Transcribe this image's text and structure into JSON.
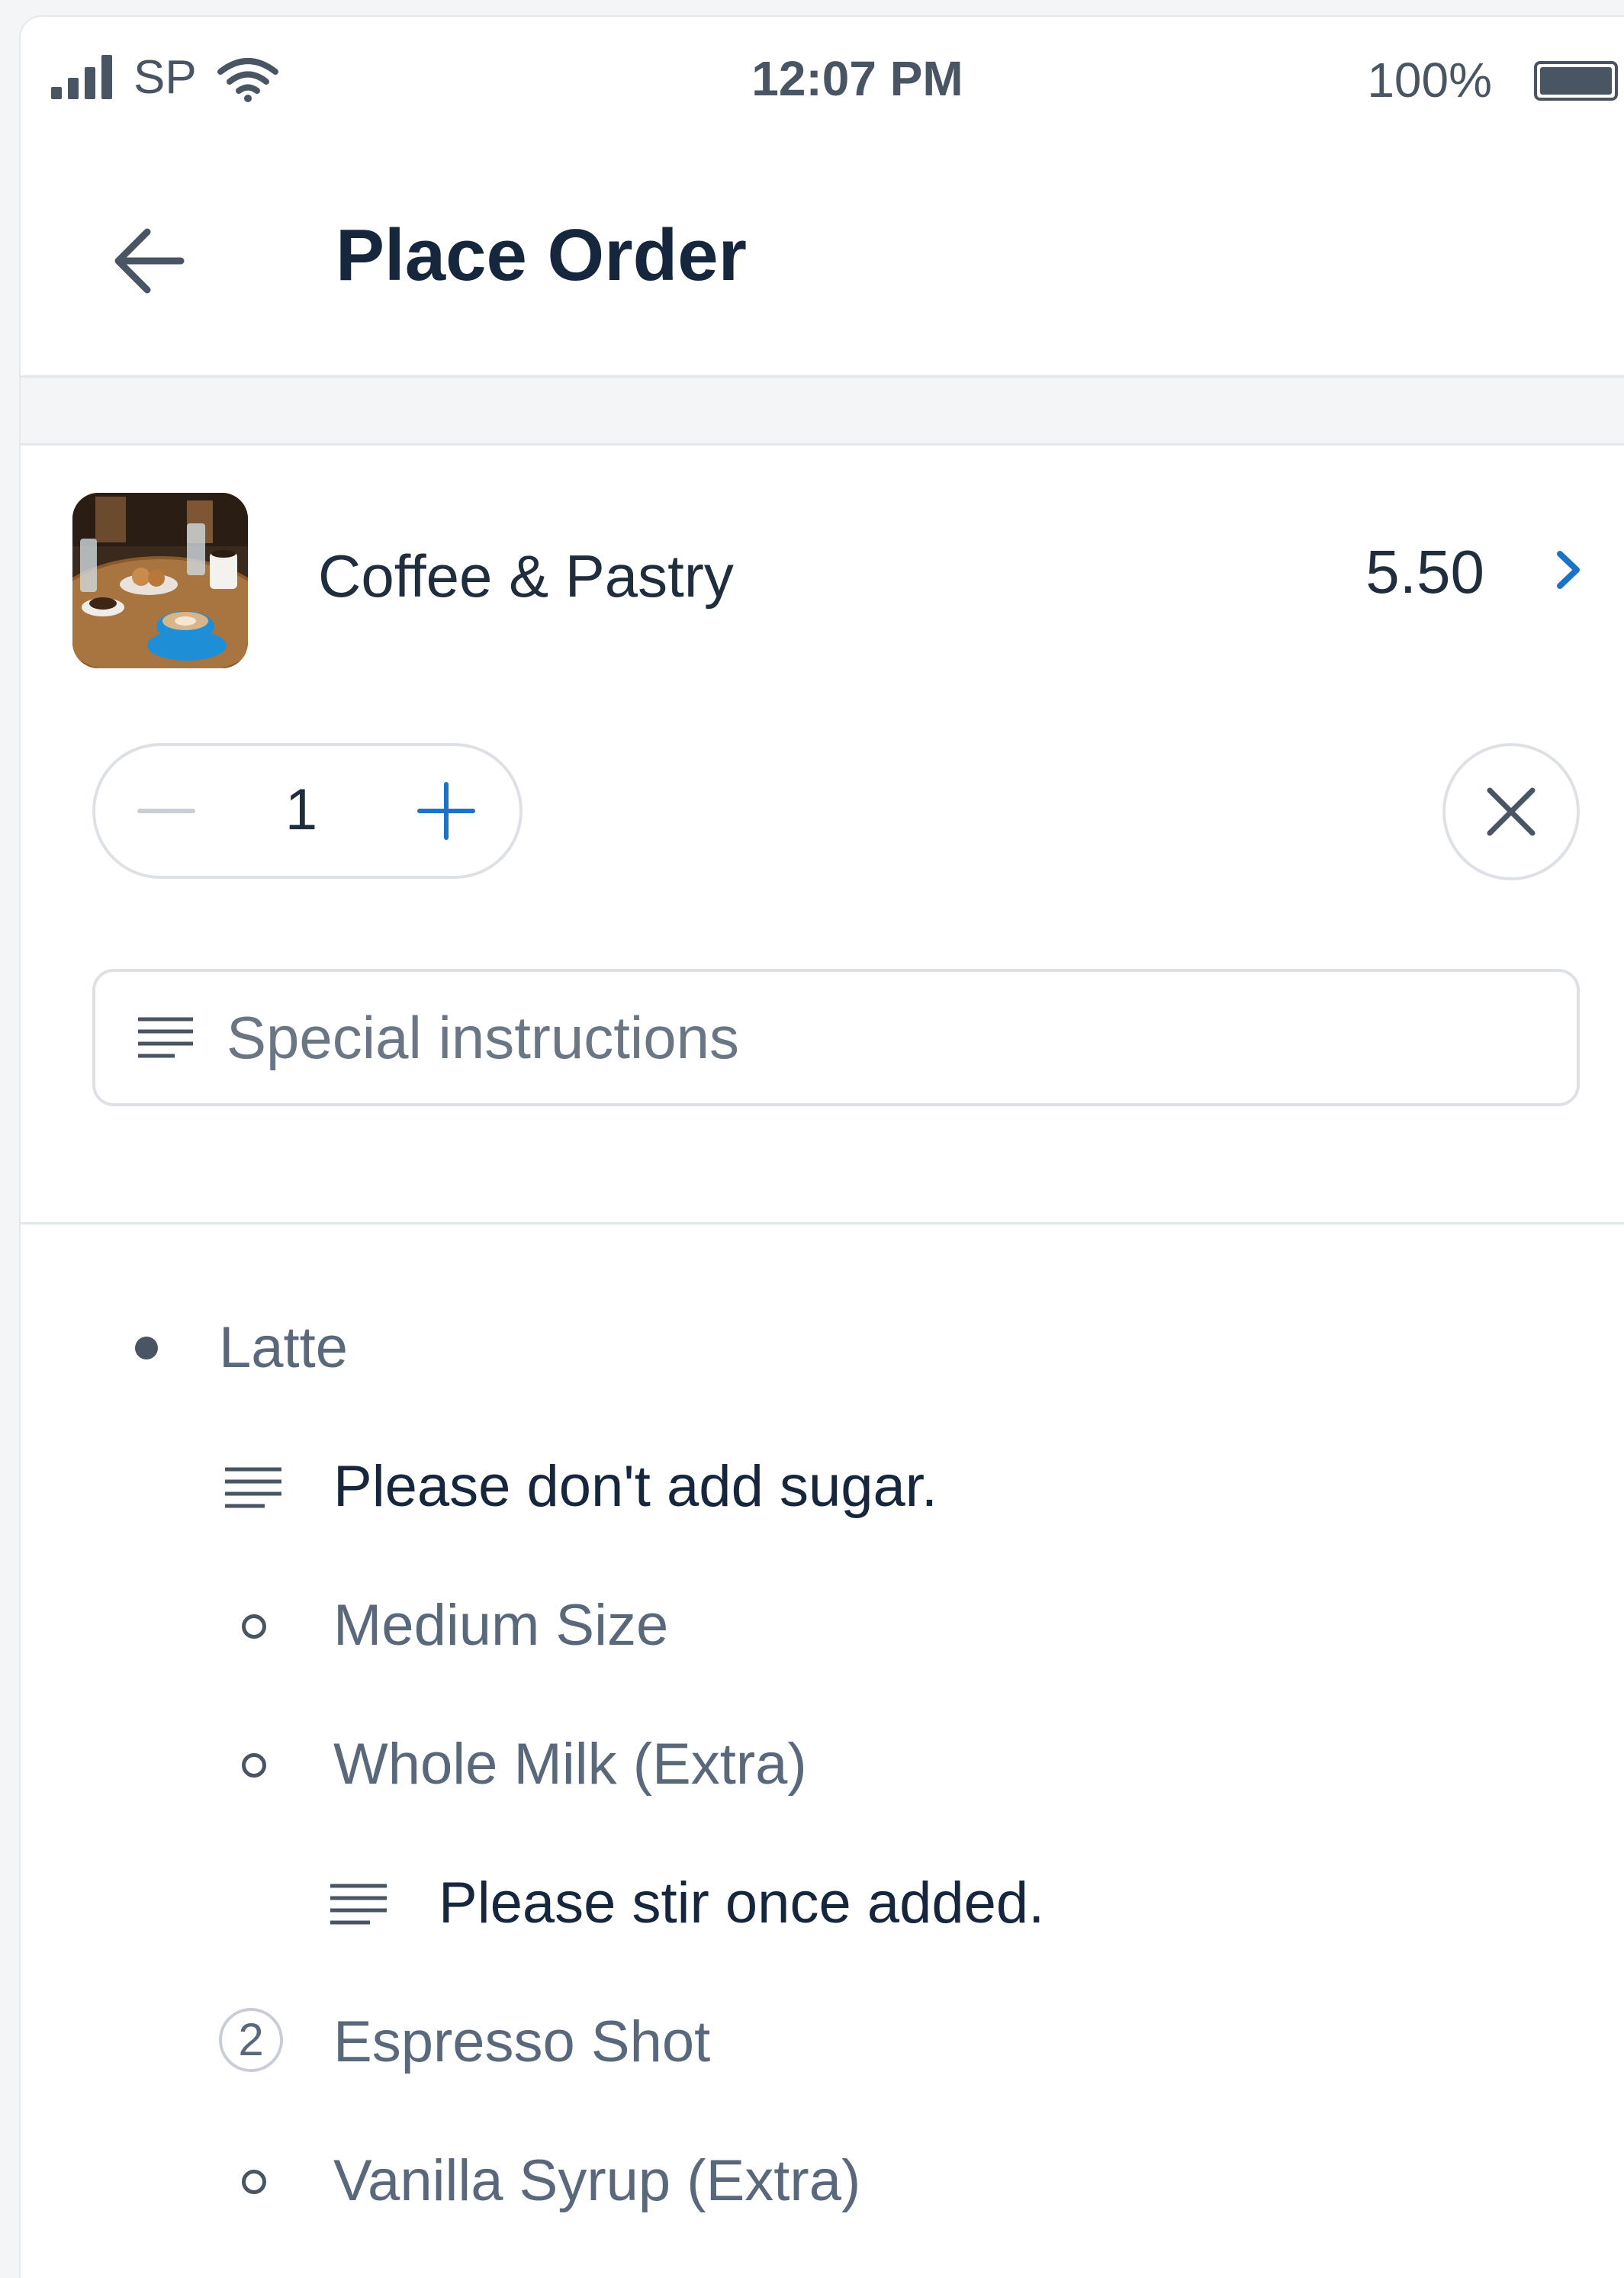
{
  "status_bar": {
    "carrier": "SP",
    "time": "12:07 PM",
    "battery": "100%",
    "icons": [
      "signal-icon",
      "wifi-icon",
      "battery-icon"
    ]
  },
  "header": {
    "title": "Place Order",
    "back_icon": "arrow-left-icon"
  },
  "item": {
    "name": "Coffee & Pastry",
    "price": "5.50",
    "thumbnail": "coffee-and-pastry-photo",
    "chevron_icon": "chevron-right-icon"
  },
  "quantity": {
    "value": "1",
    "minus_icon": "minus-icon",
    "plus_icon": "plus-icon",
    "remove_icon": "close-icon"
  },
  "special_instructions": {
    "placeholder": "Special instructions",
    "value": "",
    "icon": "notes-icon"
  },
  "options": [
    {
      "label": "Latte",
      "marker": "filled-dot",
      "level": 0,
      "style": "muted"
    },
    {
      "label": "Please don't add sugar.",
      "marker": "notes-icon",
      "level": 1,
      "style": "dark"
    },
    {
      "label": "Medium Size",
      "marker": "ring-dot",
      "level": 1,
      "style": "muted"
    },
    {
      "label": "Whole Milk (Extra)",
      "marker": "ring-dot",
      "level": 1,
      "style": "muted"
    },
    {
      "label": "Please stir once added.",
      "marker": "notes-icon",
      "level": 2,
      "style": "dark"
    },
    {
      "label": "Espresso Shot",
      "marker": "count",
      "count": "2",
      "level": 1,
      "style": "muted"
    },
    {
      "label": "Vanilla Syrup (Extra)",
      "marker": "ring-dot",
      "level": 1,
      "style": "muted"
    }
  ],
  "colors": {
    "accent": "#1a73c9",
    "text_dark": "#16263c",
    "text_muted": "#59687a",
    "border": "#dde1e6"
  }
}
